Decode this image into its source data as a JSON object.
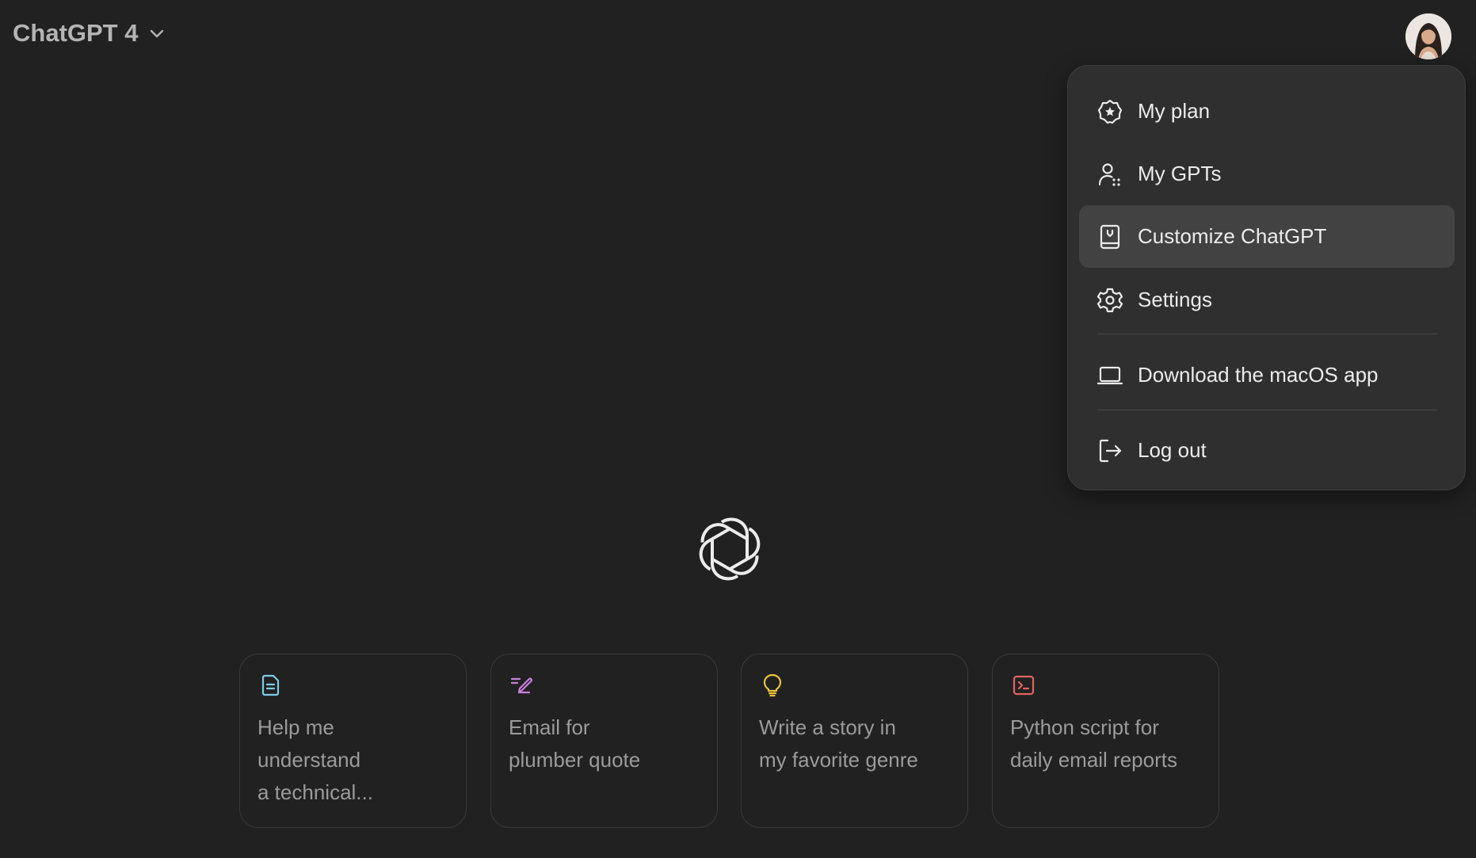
{
  "header": {
    "model_name": "ChatGPT 4"
  },
  "user_menu": {
    "items": [
      {
        "label": "My plan",
        "icon": "plan-badge-icon"
      },
      {
        "label": "My GPTs",
        "icon": "gpts-people-icon"
      },
      {
        "label": "Customize ChatGPT",
        "icon": "customize-book-icon",
        "highlighted": true
      },
      {
        "label": "Settings",
        "icon": "gear-icon"
      },
      {
        "label": "Download the macOS app",
        "icon": "laptop-icon"
      },
      {
        "label": "Log out",
        "icon": "logout-icon"
      }
    ]
  },
  "suggestions": [
    {
      "text": "Help me\nunderstand\na technical...",
      "icon": "document-icon",
      "color": "#7ecbe8"
    },
    {
      "text": "Email for\nplumber quote",
      "icon": "pen-lines-icon",
      "color": "#c87fde"
    },
    {
      "text": "Write a story in\nmy favorite genre",
      "icon": "lightbulb-icon",
      "color": "#e8c33a"
    },
    {
      "text": "Python script for\ndaily email reports",
      "icon": "terminal-icon",
      "color": "#e0655f"
    }
  ],
  "colors": {
    "background": "#212121",
    "menu_background": "#2f2f2f",
    "menu_highlight": "#424242",
    "text_primary": "#ececec",
    "text_muted": "#9b9b9b"
  }
}
